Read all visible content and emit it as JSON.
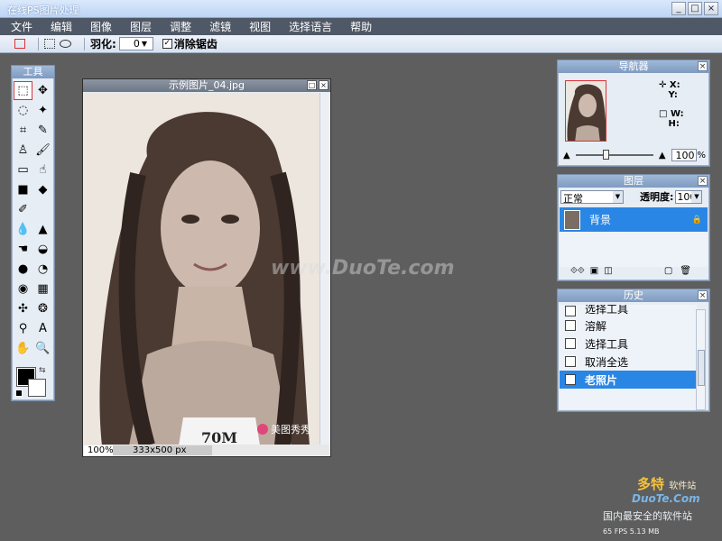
{
  "window": {
    "title": "在线PS图片处理",
    "controls": [
      "_",
      "□",
      "×"
    ]
  },
  "menu": [
    "文件",
    "编辑",
    "图像",
    "图层",
    "调整",
    "滤镜",
    "视图",
    "选择语言",
    "帮助"
  ],
  "options": {
    "feather_label": "羽化:",
    "feather_value": "0",
    "antialias_label": "消除锯齿",
    "antialias_checked": true
  },
  "tools": {
    "title": "工具",
    "items": [
      {
        "name": "marquee-tool",
        "glyph": "⬚"
      },
      {
        "name": "move-tool",
        "glyph": "✥"
      },
      {
        "name": "lasso-tool",
        "glyph": "◌"
      },
      {
        "name": "magic-wand-tool",
        "glyph": "✦"
      },
      {
        "name": "crop-tool",
        "glyph": "⌗"
      },
      {
        "name": "pencil-tool",
        "glyph": "✎"
      },
      {
        "name": "stamp-tool",
        "glyph": "♙"
      },
      {
        "name": "brush-tool",
        "glyph": "🖌"
      },
      {
        "name": "eraser-tool",
        "glyph": "▭"
      },
      {
        "name": "smudge-tool",
        "glyph": "☝"
      },
      {
        "name": "rect-shape-tool",
        "glyph": "■"
      },
      {
        "name": "bucket-tool",
        "glyph": "◆"
      },
      {
        "name": "gradient-tool",
        "glyph": "✐"
      },
      {
        "name": "blank-tool",
        "glyph": ""
      },
      {
        "name": "blur-tool",
        "glyph": "💧"
      },
      {
        "name": "sharpen-tool",
        "glyph": "▲"
      },
      {
        "name": "dodge-tool",
        "glyph": "☚"
      },
      {
        "name": "sponge-tool",
        "glyph": "◒"
      },
      {
        "name": "burn-tool",
        "glyph": "●"
      },
      {
        "name": "redeye-tool",
        "glyph": "◔"
      },
      {
        "name": "eye-tool",
        "glyph": "◉"
      },
      {
        "name": "patch-tool",
        "glyph": "▦"
      },
      {
        "name": "spot-heal-tool",
        "glyph": "✣"
      },
      {
        "name": "bloat-tool",
        "glyph": "❂"
      },
      {
        "name": "eyedropper-tool",
        "glyph": "⚲"
      },
      {
        "name": "text-tool",
        "glyph": "A"
      },
      {
        "name": "hand-tool",
        "glyph": "✋"
      },
      {
        "name": "zoom-tool",
        "glyph": "🔍"
      }
    ]
  },
  "image_window": {
    "title": "示例图片_04.jpg",
    "zoom": "100%",
    "dimensions": "333x500 px",
    "brand": "美图秀秀",
    "shirt_text": "70M"
  },
  "overlay_watermark": "www.DuoTe.com",
  "navigator": {
    "title": "导航器",
    "x_label": "X:",
    "y_label": "Y:",
    "w_label": "W:",
    "h_label": "H:",
    "zoom": "100",
    "percent": "%"
  },
  "layers": {
    "title": "图层",
    "blend_mode": "正常",
    "opacity_label": "透明度:",
    "opacity": "100",
    "items": [
      {
        "name": "背景"
      }
    ]
  },
  "history": {
    "title": "历史",
    "items": [
      {
        "label": "选择工具",
        "partial": true
      },
      {
        "label": "溶解"
      },
      {
        "label": "选择工具"
      },
      {
        "label": "取消全选"
      },
      {
        "label": "老照片",
        "active": true
      }
    ]
  },
  "site_watermark": {
    "brand": "多特",
    "suffix": "软件站",
    "url": "DuoTe.Com",
    "slogan": "国内最安全的软件站"
  },
  "fps": "65 FPS 5.13 MB"
}
